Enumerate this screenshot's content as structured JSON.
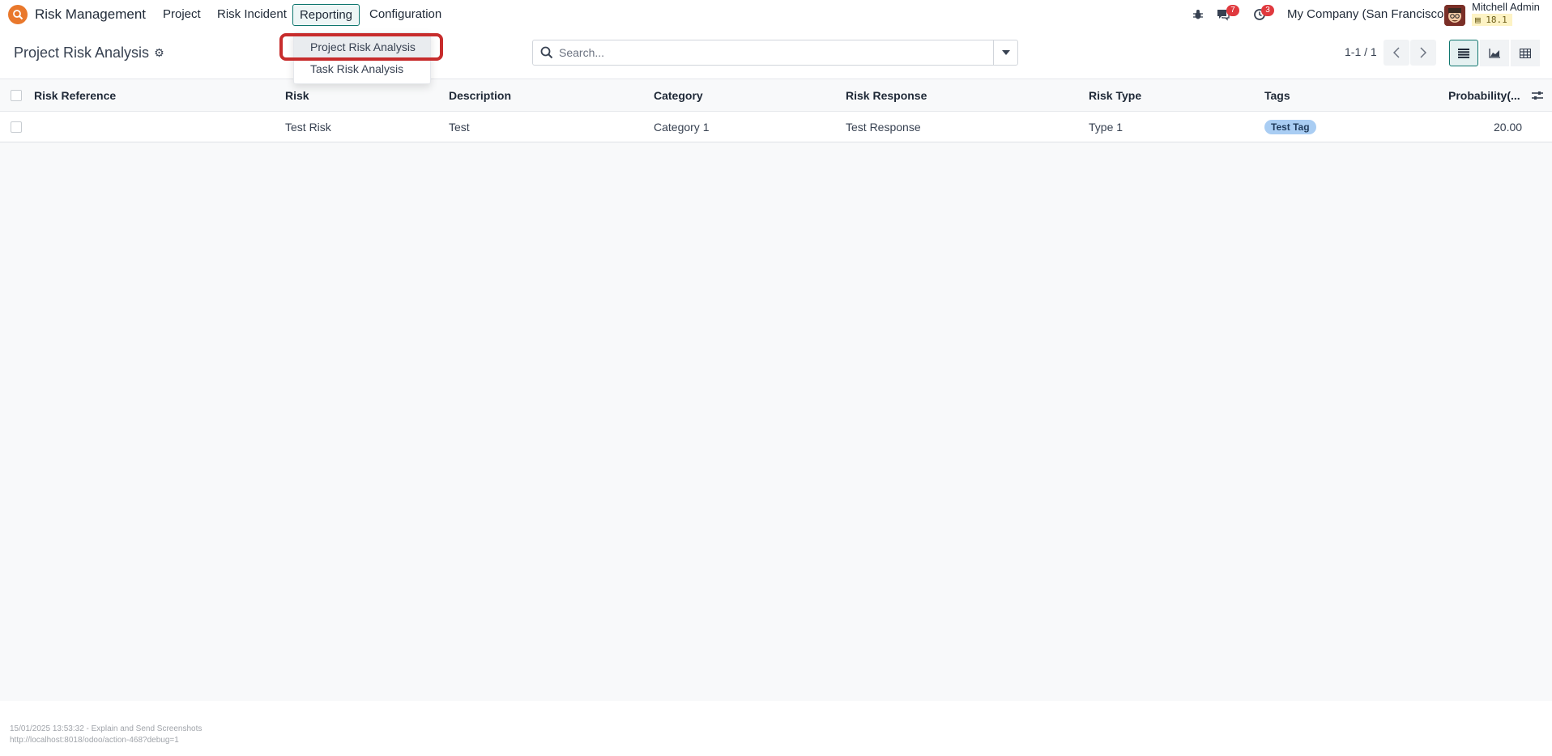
{
  "navbar": {
    "app_name": "Risk Management",
    "menu": [
      "Project",
      "Risk Incident",
      "Reporting",
      "Configuration"
    ],
    "active_menu": "Reporting",
    "messages_count": "7",
    "activities_count": "3",
    "company": "My Company (San Francisco)",
    "user_name": "Mitchell Admin",
    "version": "18.1"
  },
  "dropdown": {
    "items": [
      "Project Risk Analysis",
      "Task Risk Analysis"
    ],
    "highlighted": "Project Risk Analysis"
  },
  "control_panel": {
    "title": "Project Risk Analysis",
    "search_placeholder": "Search...",
    "pager": "1-1 / 1"
  },
  "table": {
    "columns": [
      "Risk Reference",
      "Risk",
      "Description",
      "Category",
      "Risk Response",
      "Risk Type",
      "Tags",
      "Probability(..."
    ],
    "rows": [
      {
        "risk_reference": "",
        "risk": "Test Risk",
        "description": "Test",
        "category": "Category 1",
        "risk_response": "Test Response",
        "risk_type": "Type 1",
        "tags": "Test Tag",
        "probability": "20.00"
      }
    ]
  },
  "footer": {
    "line1": "15/01/2025 13:53:32 - Explain and Send Screenshots",
    "line2": "http://localhost:8018/odoo/action-468?debug=1"
  },
  "colors": {
    "accent": "#0f766e",
    "badge": "#e0393e",
    "highlight": "#c72c2c",
    "tag": "#a9cdf3"
  }
}
